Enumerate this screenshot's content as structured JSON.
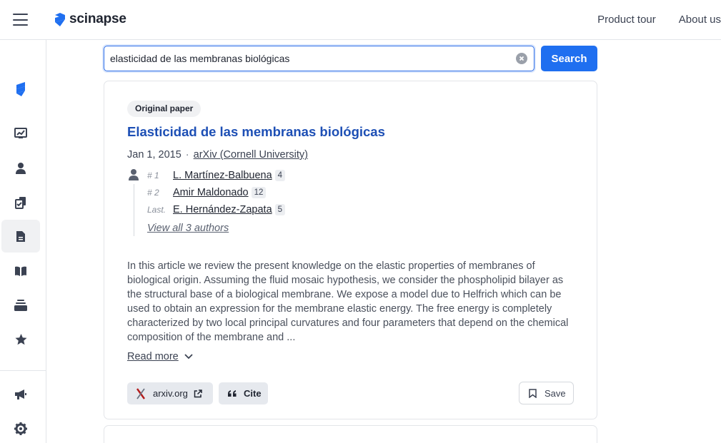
{
  "header": {
    "brand": "scinapse",
    "nav": [
      "Product tour",
      "About us"
    ]
  },
  "sidebar": {
    "items": [
      {
        "icon": "scinapse-logo-icon"
      },
      {
        "icon": "chart-icon"
      },
      {
        "icon": "person-icon"
      },
      {
        "icon": "documents-icon"
      },
      {
        "icon": "document-icon",
        "active": true
      },
      {
        "icon": "book-icon"
      },
      {
        "icon": "stack-icon"
      },
      {
        "icon": "star-icon"
      },
      {
        "icon": "megaphone-icon"
      },
      {
        "icon": "gear-icon"
      }
    ]
  },
  "search": {
    "query": "elasticidad de las membranas biológicas",
    "button": "Search"
  },
  "paper": {
    "badge": "Original paper",
    "title": "Elasticidad de las membranas biológicas",
    "date": "Jan 1, 2015",
    "separator": "·",
    "venue": "arXiv (Cornell University)",
    "authors": [
      {
        "rank": "# 1",
        "name": "L. Martínez-Balbuena",
        "count": "4"
      },
      {
        "rank": "# 2",
        "name": "Amir Maldonado",
        "count": "12"
      },
      {
        "rank": "Last.",
        "name": "E. Hernández-Zapata",
        "count": "5"
      }
    ],
    "view_all": "View all 3 authors",
    "abstract": "In this article we review the present knowledge on the elastic properties of membranes of biological origin. Assuming the fluid mosaic hypothesis, we consider the phospholipid bilayer as the structural base of a biological membrane. We expose a model due to Helfrich which can be used to obtain an expression for the membrane elastic energy. The free energy is completely characterized by two local principal curvatures and four parameters that depend on the chemical composition of the membrane and ...",
    "read_more": "Read more",
    "source_chip": "arxiv.org",
    "cite": "Cite",
    "save": "Save"
  },
  "colors": {
    "accent": "#1f6ff0",
    "title": "#1d4fb5"
  }
}
